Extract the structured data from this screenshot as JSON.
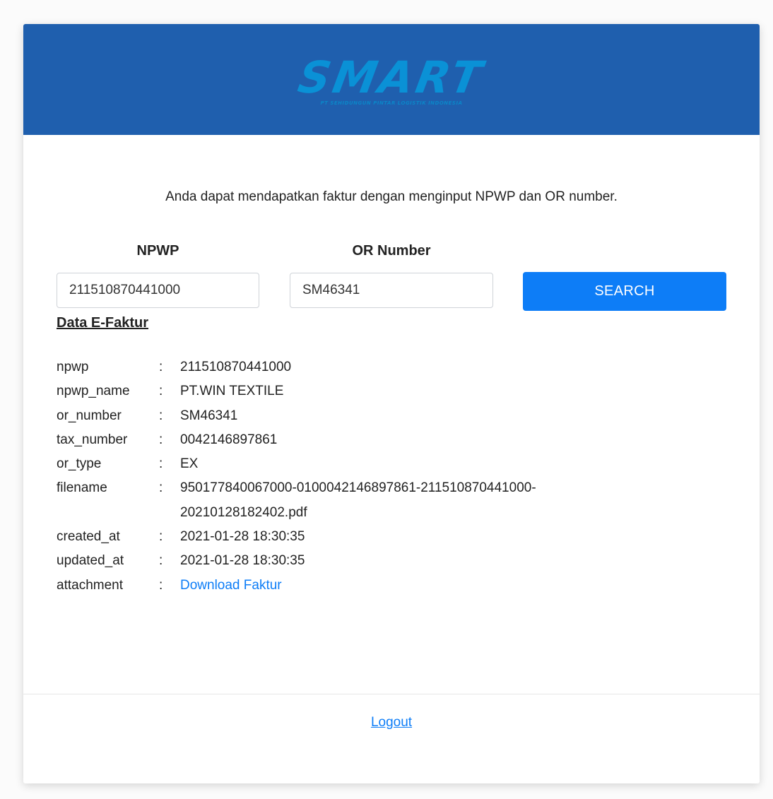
{
  "header": {
    "logo_text": "SMART",
    "logo_subtitle": "PT SEHIDUNGUN PINTAR LOGISTIK INDONESIA"
  },
  "intro_text": "Anda dapat mendapatkan faktur dengan menginput NPWP dan OR number.",
  "form": {
    "npwp_label": "NPWP",
    "npwp_value": "211510870441000",
    "or_label": "OR Number",
    "or_value": "SM46341",
    "search_label": "SEARCH"
  },
  "section_title": "Data E-Faktur",
  "separator": ":",
  "details": [
    {
      "key": "npwp",
      "value": "211510870441000"
    },
    {
      "key": "npwp_name",
      "value": "PT.WIN TEXTILE"
    },
    {
      "key": "or_number",
      "value": "SM46341"
    },
    {
      "key": "tax_number",
      "value": "0042146897861"
    },
    {
      "key": "or_type",
      "value": "EX"
    },
    {
      "key": "filename",
      "value": "950177840067000-0100042146897861-211510870441000-20210128182402.pdf"
    },
    {
      "key": "created_at",
      "value": "2021-01-28 18:30:35"
    },
    {
      "key": "updated_at",
      "value": "2021-01-28 18:30:35"
    },
    {
      "key": "attachment",
      "value": "Download Faktur"
    }
  ],
  "footer": {
    "logout_label": "Logout"
  },
  "colors": {
    "header_bg": "#1f5fae",
    "accent": "#0d7df7",
    "logo": "#0a91d6"
  }
}
